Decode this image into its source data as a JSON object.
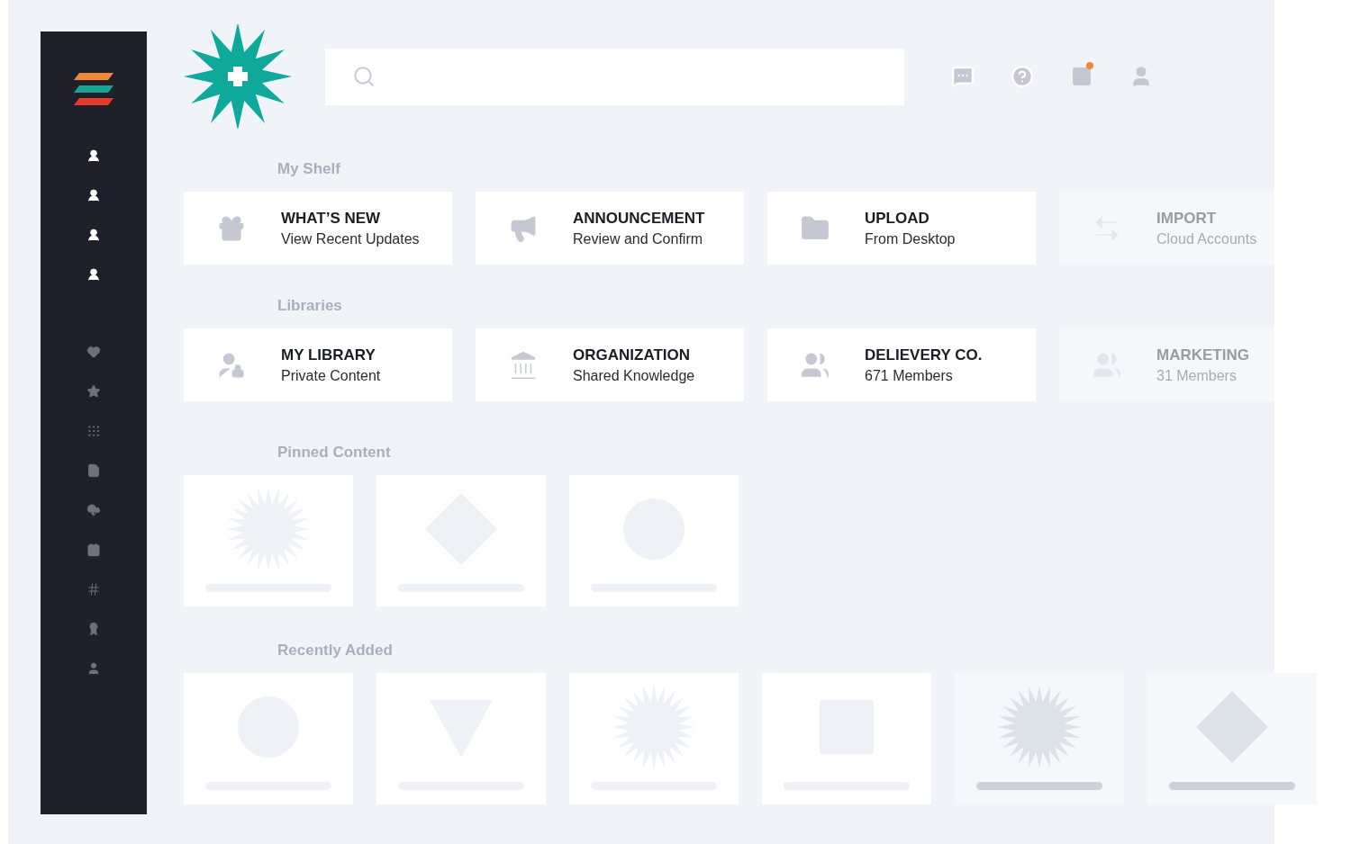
{
  "sections": [
    {
      "title": "My Shelf",
      "kind": "cards",
      "items": [
        {
          "title": "WHAT’S NEW",
          "subtitle": "View Recent Updates",
          "dimmed": false
        },
        {
          "title": "ANNOUNCEMENT",
          "subtitle": "Review and Confirm",
          "dimmed": false
        },
        {
          "title": "UPLOAD",
          "subtitle": "From Desktop",
          "dimmed": false
        },
        {
          "title": "IMPORT",
          "subtitle": "Cloud Accounts",
          "dimmed": true
        }
      ]
    },
    {
      "title": "Libraries",
      "kind": "cards",
      "items": [
        {
          "title": "MY LIBRARY",
          "subtitle": "Private Content",
          "dimmed": false
        },
        {
          "title": "ORGANIZATION",
          "subtitle": "Shared Knowledge",
          "dimmed": false
        },
        {
          "title": "DELIEVERY CO.",
          "subtitle": "671 Members",
          "dimmed": false
        },
        {
          "title": "MARKETING",
          "subtitle": "31 Members",
          "dimmed": true
        }
      ]
    },
    {
      "title": "Pinned Content",
      "kind": "tiles",
      "items": [
        {
          "kind": "burst",
          "dimmed": false
        },
        {
          "kind": "diamond",
          "dimmed": false
        },
        {
          "kind": "circle",
          "dimmed": false
        }
      ]
    },
    {
      "title": "Recently Added",
      "kind": "tiles",
      "items": [
        {
          "kind": "circle",
          "dimmed": false
        },
        {
          "kind": "triangle",
          "dimmed": false
        },
        {
          "kind": "burst",
          "dimmed": false
        },
        {
          "kind": "square",
          "dimmed": false
        },
        {
          "kind": "burst",
          "dimmed": true
        },
        {
          "kind": "diamond",
          "dimmed": true
        }
      ]
    }
  ]
}
